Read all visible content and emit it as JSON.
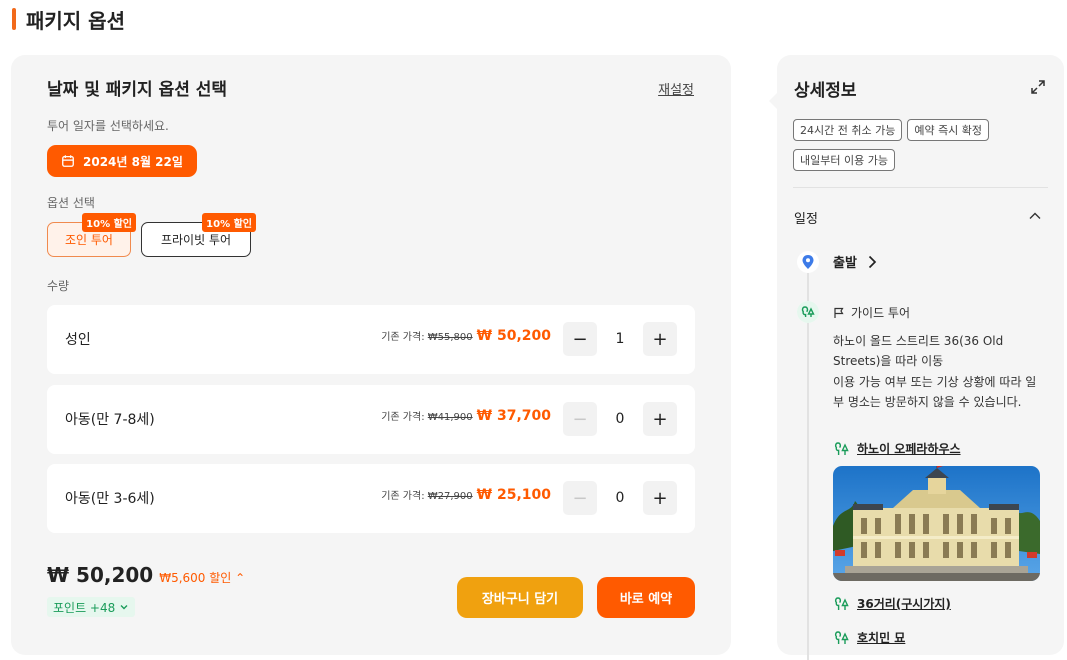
{
  "page": {
    "title": "패키지 옵션"
  },
  "left": {
    "heading": "날짜 및 패키지 옵션 선택",
    "reset": "재설정",
    "date_hint": "투어 일자를 선택하세요.",
    "date": "2024년 8월 22일",
    "option_label": "옵션 선택",
    "options": [
      {
        "label": "조인 투어",
        "badge": "10% 할인",
        "selected": true
      },
      {
        "label": "프라이빗 투어",
        "badge": "10% 할인",
        "selected": false
      }
    ],
    "qty_label": "수량",
    "rows": [
      {
        "name": "성인",
        "orig_label": "기존 가격:",
        "orig_price": "₩55,800",
        "sale": "₩ 50,200",
        "count": "1",
        "minus_enabled": true
      },
      {
        "name": "아동(만 7-8세)",
        "orig_label": "기존 가격:",
        "orig_price": "₩41,900",
        "sale": "₩ 37,700",
        "count": "0",
        "minus_enabled": false
      },
      {
        "name": "아동(만 3-6세)",
        "orig_label": "기존 가격:",
        "orig_price": "₩27,900",
        "sale": "₩ 25,100",
        "count": "0",
        "minus_enabled": false
      }
    ],
    "total": "₩ 50,200",
    "discount": "₩5,600 할인",
    "points": "포인트 +48",
    "cart": "장바구니 담기",
    "book": "바로 예약"
  },
  "right": {
    "title": "상세정보",
    "tags": [
      "24시간 전 취소 가능",
      "예약 즉시 확정",
      "내일부터 이용 가능"
    ],
    "schedule_title": "일정",
    "start": "출발",
    "guide": "가이드 투어",
    "desc1": "하노이 올드 스트리트 36(36 Old Streets)을 따라 이동",
    "desc2": "이용 가능 여부 또는 기상 상황에 따라 일부 명소는 방문하지 않을 수 있습니다.",
    "places": [
      "하노이 오페라하우스",
      "36거리(구시가지)",
      "호치민 묘"
    ]
  },
  "colors": {
    "accent": "#ff5a00",
    "cart": "#f0a10f",
    "green": "#1a9c5a"
  }
}
